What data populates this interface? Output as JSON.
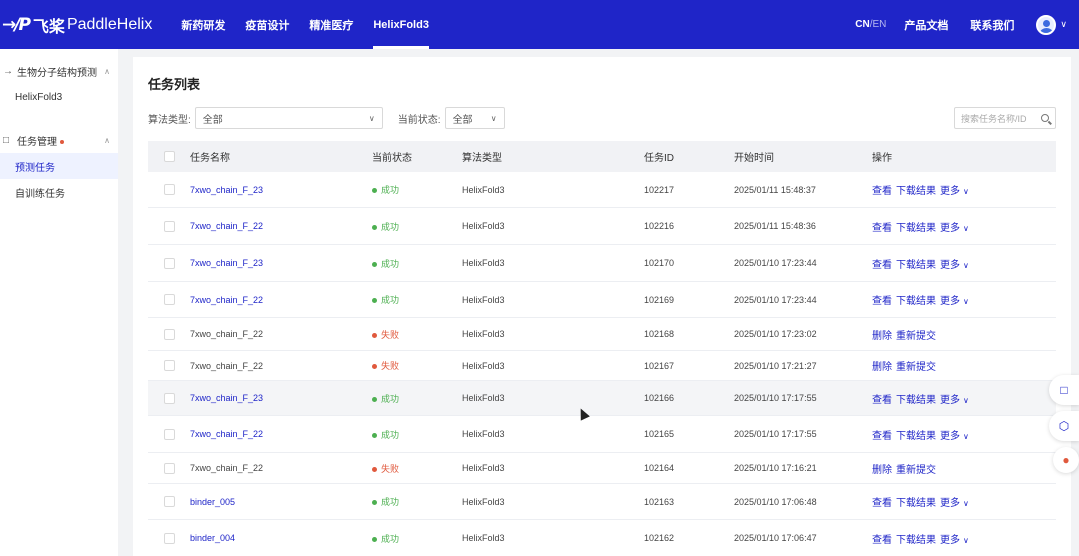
{
  "header": {
    "logo_mark": "→/P",
    "logo_cn": "飞桨",
    "logo_en": "PaddleHelix",
    "nav": [
      {
        "label": "新药研发"
      },
      {
        "label": "疫苗设计"
      },
      {
        "label": "精准医疗"
      },
      {
        "label": "HelixFold3"
      }
    ],
    "active_nav": "HelixFold3",
    "lang_active": "CN",
    "lang_sep": "/",
    "lang_other": "EN",
    "docs": "产品文档",
    "contact": "联系我们",
    "avatar_caret": "∨"
  },
  "sidebar": {
    "group1": {
      "icon": "→",
      "label": "生物分子结构预测",
      "caret": "∧"
    },
    "group1_items": [
      {
        "label": "HelixFold3"
      }
    ],
    "group2": {
      "icon": "□",
      "label": "任务管理",
      "caret": "∧"
    },
    "group2_items": [
      {
        "label": "预测任务",
        "active": true
      },
      {
        "label": "自训练任务"
      }
    ]
  },
  "main": {
    "title": "任务列表",
    "filters": {
      "algo_label": "算法类型:",
      "algo_value": "全部",
      "status_label": "当前状态:",
      "status_value": "全部",
      "search_placeholder": "搜索任务名称/ID"
    },
    "columns": {
      "name": "任务名称",
      "status": "当前状态",
      "algo": "算法类型",
      "id": "任务ID",
      "time": "开始时间",
      "ops": "操作"
    },
    "ops_labels": {
      "view": "查看",
      "download": "下载结果",
      "more": "更多",
      "delete": "删除",
      "resubmit": "重新提交"
    },
    "rows": [
      {
        "name": "7xwo_chain_F_23",
        "status": "成功",
        "ok": true,
        "algo": "HelixFold3",
        "id": "102217",
        "time": "2025/01/11 15:48:37"
      },
      {
        "name": "7xwo_chain_F_22",
        "status": "成功",
        "ok": true,
        "algo": "HelixFold3",
        "id": "102216",
        "time": "2025/01/11 15:48:36"
      },
      {
        "name": "7xwo_chain_F_23",
        "status": "成功",
        "ok": true,
        "algo": "HelixFold3",
        "id": "102170",
        "time": "2025/01/10 17:23:44"
      },
      {
        "name": "7xwo_chain_F_22",
        "status": "成功",
        "ok": true,
        "algo": "HelixFold3",
        "id": "102169",
        "time": "2025/01/10 17:23:44"
      },
      {
        "name": "7xwo_chain_F_22",
        "status": "失败",
        "ok": false,
        "algo": "HelixFold3",
        "id": "102168",
        "time": "2025/01/10 17:23:02"
      },
      {
        "name": "7xwo_chain_F_22",
        "status": "失败",
        "ok": false,
        "algo": "HelixFold3",
        "id": "102167",
        "time": "2025/01/10 17:21:27"
      },
      {
        "name": "7xwo_chain_F_23",
        "status": "成功",
        "ok": true,
        "algo": "HelixFold3",
        "id": "102166",
        "time": "2025/01/10 17:17:55"
      },
      {
        "name": "7xwo_chain_F_22",
        "status": "成功",
        "ok": true,
        "algo": "HelixFold3",
        "id": "102165",
        "time": "2025/01/10 17:17:55"
      },
      {
        "name": "7xwo_chain_F_22",
        "status": "失败",
        "ok": false,
        "algo": "HelixFold3",
        "id": "102164",
        "time": "2025/01/10 17:16:21"
      },
      {
        "name": "binder_005",
        "status": "成功",
        "ok": true,
        "algo": "HelixFold3",
        "id": "102163",
        "time": "2025/01/10 17:06:48"
      },
      {
        "name": "binder_004",
        "status": "成功",
        "ok": true,
        "algo": "HelixFold3",
        "id": "102162",
        "time": "2025/01/10 17:06:47"
      }
    ]
  },
  "colors": {
    "brand": "#1f25c8",
    "success": "#4caf50",
    "fail": "#e0593d"
  }
}
